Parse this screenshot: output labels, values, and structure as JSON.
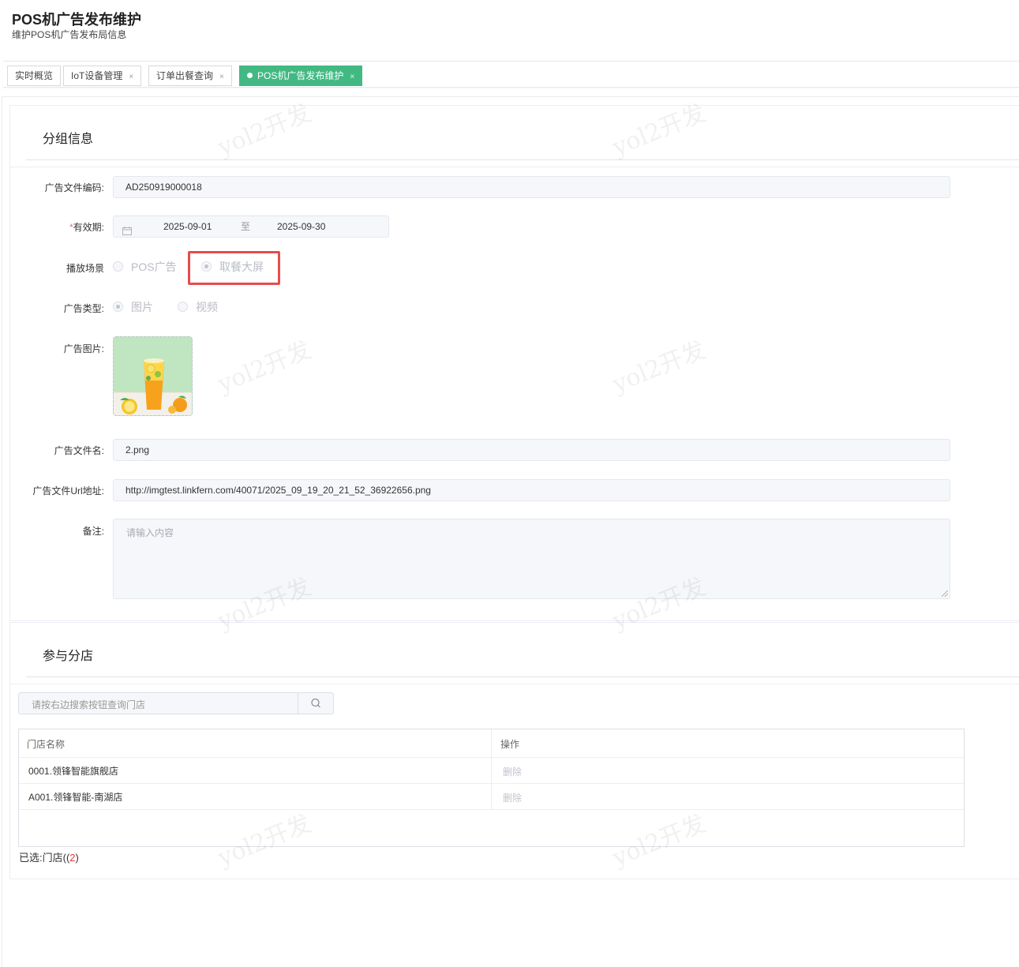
{
  "header": {
    "title": "POS机广告发布维护",
    "subtitle": "维护POS机广告发布局信息"
  },
  "tabs": [
    {
      "label": "实时概览",
      "closable": false,
      "active": false
    },
    {
      "label": "IoT设备管理",
      "closable": true,
      "active": false
    },
    {
      "label": "订单出餐查询",
      "closable": true,
      "active": false
    },
    {
      "label": "POS机广告发布维护",
      "closable": true,
      "active": true
    }
  ],
  "tab_close_glyph": "×",
  "group_info": {
    "title": "分组信息",
    "ad_code_label": "广告文件编码:",
    "ad_code_value": "AD250919000018",
    "validity_required_mark": "*",
    "validity_label": "有效期:",
    "validity_start": "2025-09-01",
    "validity_separator": "至",
    "validity_end": "2025-09-30",
    "scene_label": "播放场景",
    "scene_options": [
      "POS广告",
      "取餐大屏"
    ],
    "scene_selected": "取餐大屏",
    "type_label": "广告类型:",
    "type_options": [
      "图片",
      "视频"
    ],
    "type_selected": "图片",
    "image_label": "广告图片:",
    "filename_label": "广告文件名:",
    "filename_value": "2.png",
    "url_label": "广告文件Url地址:",
    "url_value": "http://imgtest.linkfern.com/40071/2025_09_19_20_21_52_36922656.png",
    "remark_label": "备注:",
    "remark_placeholder": "请输入内容"
  },
  "stores": {
    "title": "参与分店",
    "search_placeholder": "请按右边搜索按钮查询门店",
    "columns": [
      "门店名称",
      "操作"
    ],
    "rows": [
      {
        "name": "0001.领锋智能旗舰店",
        "action": "删除"
      },
      {
        "name": "A001.领锋智能-南湖店",
        "action": "删除"
      }
    ],
    "selected_prefix": "已选:门店((",
    "selected_count": "2",
    "selected_suffix": ")"
  },
  "watermark_text": "yol2开发",
  "colors": {
    "accent": "#42b983",
    "highlight": "#e74c4c",
    "required": "#f56c6c",
    "count": "#e4393c"
  }
}
